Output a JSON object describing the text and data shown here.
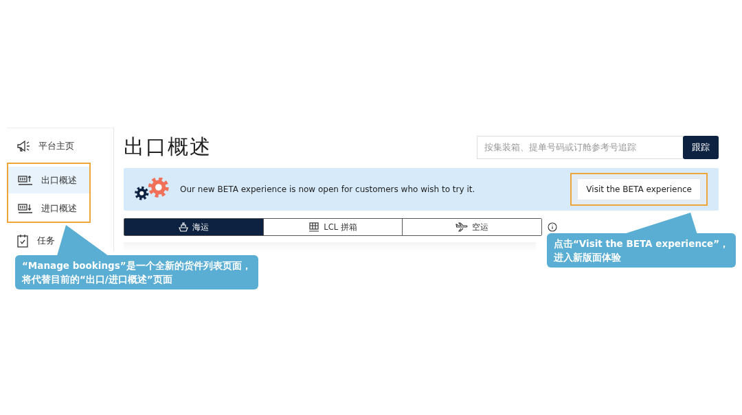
{
  "sidebar": {
    "items": [
      {
        "label": "平台主页",
        "kind": "megaphone",
        "selected": false,
        "highlighted": false
      },
      {
        "label": "出口概述",
        "kind": "export",
        "selected": true,
        "highlighted": true
      },
      {
        "label": "进口概述",
        "kind": "import",
        "selected": false,
        "highlighted": true
      },
      {
        "label": "任务",
        "kind": "tasks",
        "selected": false,
        "highlighted": false
      }
    ]
  },
  "page_title": "出口概述",
  "search": {
    "placeholder": "按集装箱、提单号码或订舱参考号追踪",
    "button": "跟踪"
  },
  "banner": {
    "message": "Our new BETA experience is now open for customers who wish to try it.",
    "button": "Visit the BETA experience"
  },
  "tabs": [
    {
      "label": "海运",
      "kind": "ship",
      "selected": true
    },
    {
      "label": "LCL 拼箱",
      "kind": "lcl",
      "selected": false
    },
    {
      "label": "空运",
      "kind": "plane",
      "selected": false
    }
  ],
  "callouts": [
    {
      "lines": [
        "“Manage bookings”是一个全新的货件列表页面，",
        "将代替目前的“出口/进口概述”页面"
      ]
    },
    {
      "lines": [
        "点击“Visit the BETA experience”，",
        "进入新版面体验"
      ]
    }
  ]
}
